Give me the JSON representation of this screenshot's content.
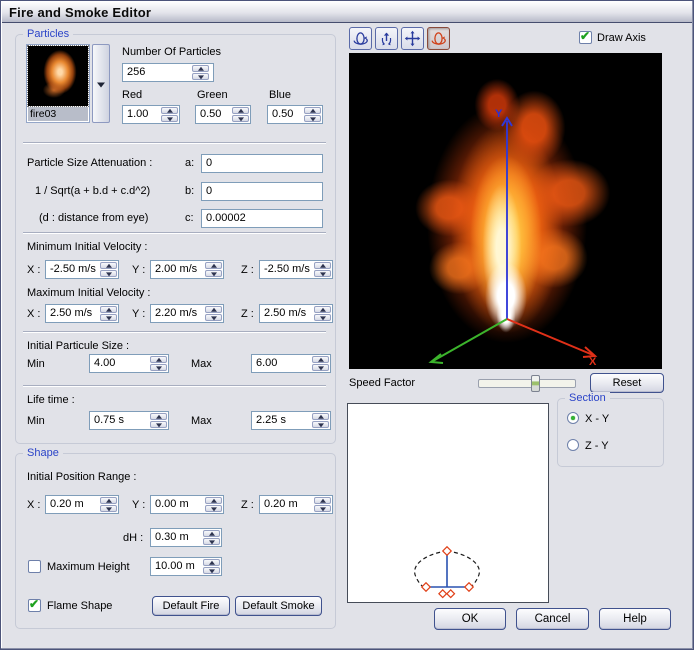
{
  "window": {
    "title": "Fire and Smoke Editor"
  },
  "icons": {
    "check": "✔"
  },
  "particles": {
    "group_label": "Particles",
    "texture": {
      "name": "fire03"
    },
    "count": {
      "label": "Number Of Particles",
      "value": "256"
    },
    "color": {
      "red_label": "Red",
      "green_label": "Green",
      "blue_label": "Blue",
      "red": "1.00",
      "green": "0.50",
      "blue": "0.50"
    },
    "attenuation": {
      "label": "Particle Size Attenuation :",
      "formula": "1 / Sqrt(a + b.d + c.d^2)",
      "hint": "(d : distance from eye)",
      "a_label": "a:",
      "a_value": "0",
      "b_label": "b:",
      "b_value": "0",
      "c_label": "c:",
      "c_value": "0.00002"
    },
    "min_velocity": {
      "label": "Minimum Initial Velocity :",
      "x_label": "X :",
      "y_label": "Y :",
      "z_label": "Z :",
      "x": "-2.50 m/s",
      "y": "2.00 m/s",
      "z": "-2.50 m/s"
    },
    "max_velocity": {
      "label": "Maximum Initial Velocity :",
      "x_label": "X :",
      "y_label": "Y :",
      "z_label": "Z :",
      "x": "2.50 m/s",
      "y": "2.20 m/s",
      "z": "2.50 m/s"
    },
    "size": {
      "label": "Initial Particule Size :",
      "min_label": "Min",
      "max_label": "Max",
      "min": "4.00",
      "max": "6.00"
    },
    "life": {
      "label": "Life time :",
      "min_label": "Min",
      "max_label": "Max",
      "min": "0.75 s",
      "max": "2.25 s"
    }
  },
  "shape": {
    "group_label": "Shape",
    "position_range": {
      "label": "Initial Position Range :",
      "x_label": "X :",
      "y_label": "Y :",
      "z_label": "Z :",
      "x": "0.20 m",
      "y": "0.00 m",
      "z": "0.20 m"
    },
    "dh": {
      "label": "dH :",
      "value": "0.30 m"
    },
    "max_height": {
      "label": "Maximum Height",
      "value": "10.00 m",
      "checked": false
    },
    "flame_shape": {
      "label": "Flame Shape",
      "checked": true
    },
    "default_fire_label": "Default Fire",
    "default_smoke_label": "Default Smoke"
  },
  "viewport": {
    "toolbar": [
      {
        "name": "rotate-horizontal"
      },
      {
        "name": "rotate-vertical"
      },
      {
        "name": "pan"
      },
      {
        "name": "rotate-object",
        "active": true
      }
    ],
    "draw_axis": {
      "label": "Draw Axis",
      "checked": true
    },
    "axes": {
      "x_label": "X",
      "y_label": "Y",
      "x_color": "#e03018",
      "y_color": "#3038d8",
      "z_color": "#3cb42c"
    },
    "speed_factor": {
      "label": "Speed Factor"
    },
    "reset_label": "Reset",
    "section": {
      "group_label": "Section",
      "options": [
        {
          "label": "X - Y",
          "selected": true
        },
        {
          "label": "Z - Y",
          "selected": false
        }
      ]
    }
  },
  "footer": {
    "ok_label": "OK",
    "cancel_label": "Cancel",
    "help_label": "Help"
  },
  "colors": {
    "group_label_blue": "#2b44c8",
    "check_green": "#1fa11f",
    "dialog_bg": "#e1e2e8",
    "field_border": "#7f9db9"
  }
}
